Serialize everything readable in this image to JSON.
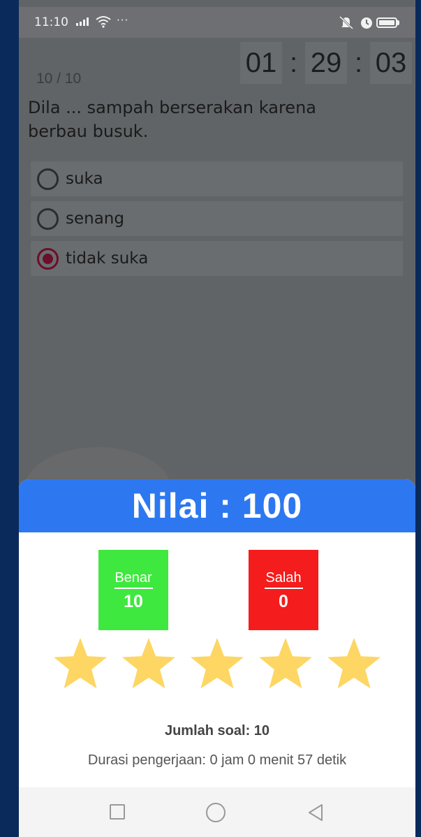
{
  "status_bar": {
    "time": "11:10",
    "more": "···"
  },
  "quiz": {
    "counter": "10 / 10",
    "timer": {
      "hours": "01",
      "minutes": "29",
      "seconds": "03",
      "separator": ":"
    },
    "question": "Dila ... sampah berserakan karena berbau busuk.",
    "options": [
      {
        "label": "suka",
        "selected": false
      },
      {
        "label": "senang",
        "selected": false
      },
      {
        "label": "tidak suka",
        "selected": true
      }
    ]
  },
  "result_dialog": {
    "title": "Nilai : 100",
    "correct": {
      "label": "Benar",
      "value": "10",
      "color": "#3ee83e"
    },
    "wrong": {
      "label": "Salah",
      "value": "0",
      "color": "#f41c1c"
    },
    "stars": {
      "filled": 5,
      "total": 5,
      "color": "#fdd663"
    },
    "total_questions": "Jumlah soal: 10",
    "duration": "Durasi pengerjaan: 0 jam 0 menit 57 detik",
    "header_color": "#2d78f0"
  },
  "nav_bar": {
    "buttons": [
      "recents-icon",
      "home-icon",
      "back-icon"
    ]
  }
}
